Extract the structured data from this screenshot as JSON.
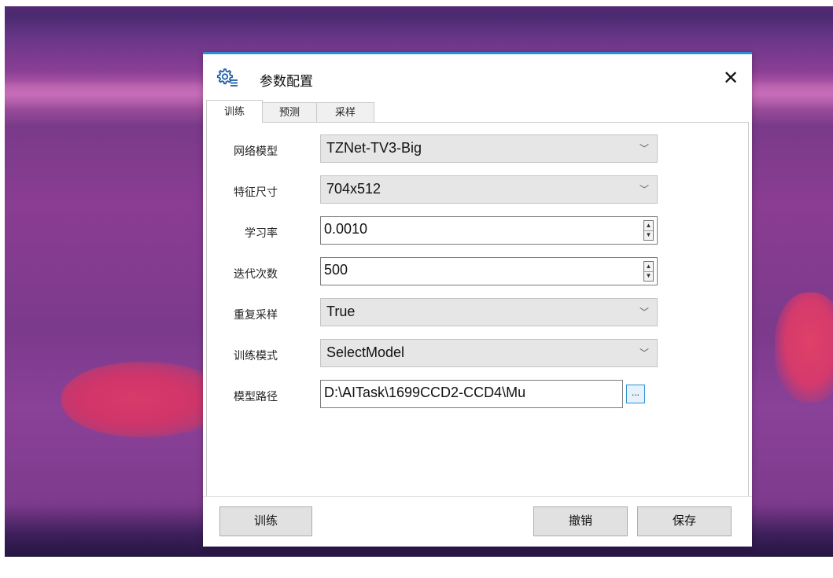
{
  "dialog": {
    "title": "参数配置",
    "close_label": "✕"
  },
  "tabs": [
    {
      "label": "训练",
      "active": true
    },
    {
      "label": "预测",
      "active": false
    },
    {
      "label": "采样",
      "active": false
    }
  ],
  "form": {
    "network_model": {
      "label": "网络模型",
      "value": "TZNet-TV3-Big"
    },
    "feature_size": {
      "label": "特征尺寸",
      "value": "704x512"
    },
    "learning_rate": {
      "label": "学习率",
      "value": "0.0010"
    },
    "iterations": {
      "label": "迭代次数",
      "value": "500"
    },
    "resample": {
      "label": "重复采样",
      "value": "True"
    },
    "train_mode": {
      "label": "训练模式",
      "value": "SelectModel"
    },
    "model_path": {
      "label": "模型路径",
      "value": "D:\\AITask\\1699CCD2-CCD4\\Mu",
      "browse_label": "..."
    }
  },
  "buttons": {
    "train": "训练",
    "cancel": "撤销",
    "save": "保存"
  },
  "colors": {
    "accent": "#2b8fd6"
  }
}
